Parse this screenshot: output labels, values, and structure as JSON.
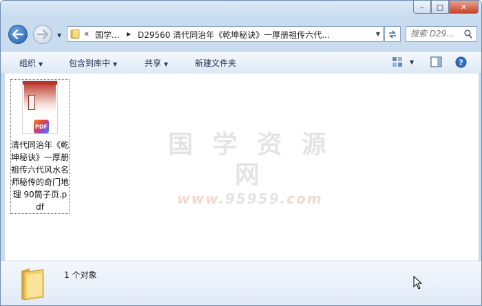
{
  "window": {
    "caption": {
      "minimize": "–",
      "maximize": "□",
      "close": "✕"
    }
  },
  "navigation": {
    "back_icon": "back-arrow-icon",
    "forward_icon": "forward-arrow-icon",
    "breadcrumb": [
      {
        "label": "«"
      },
      {
        "label": "国学..."
      },
      {
        "label": "D29560 清代同治年《乾坤秘诀》一厚册祖传六代..."
      }
    ],
    "search_placeholder": "搜索 D29..."
  },
  "toolbar": {
    "organize": "组织",
    "include_in_library": "包含到库中",
    "share": "共享",
    "new_folder": "新建文件夹"
  },
  "files": [
    {
      "name": "清代同治年《乾坤秘诀》一厚册祖传六代风水名师秘传的奇门地理 90筒子页.pdf",
      "type": "pdf",
      "badge": "PDF"
    }
  ],
  "watermark": {
    "name": "国 学 资 源 网",
    "url_prefix": "www.",
    "url_main": "95959",
    "url_suffix": ".com"
  },
  "details": {
    "status": "1 个对象"
  },
  "colors": {
    "window_frame": "#c9dcef",
    "toolbar_text": "#1e3356",
    "close_button": "#c7442a"
  }
}
